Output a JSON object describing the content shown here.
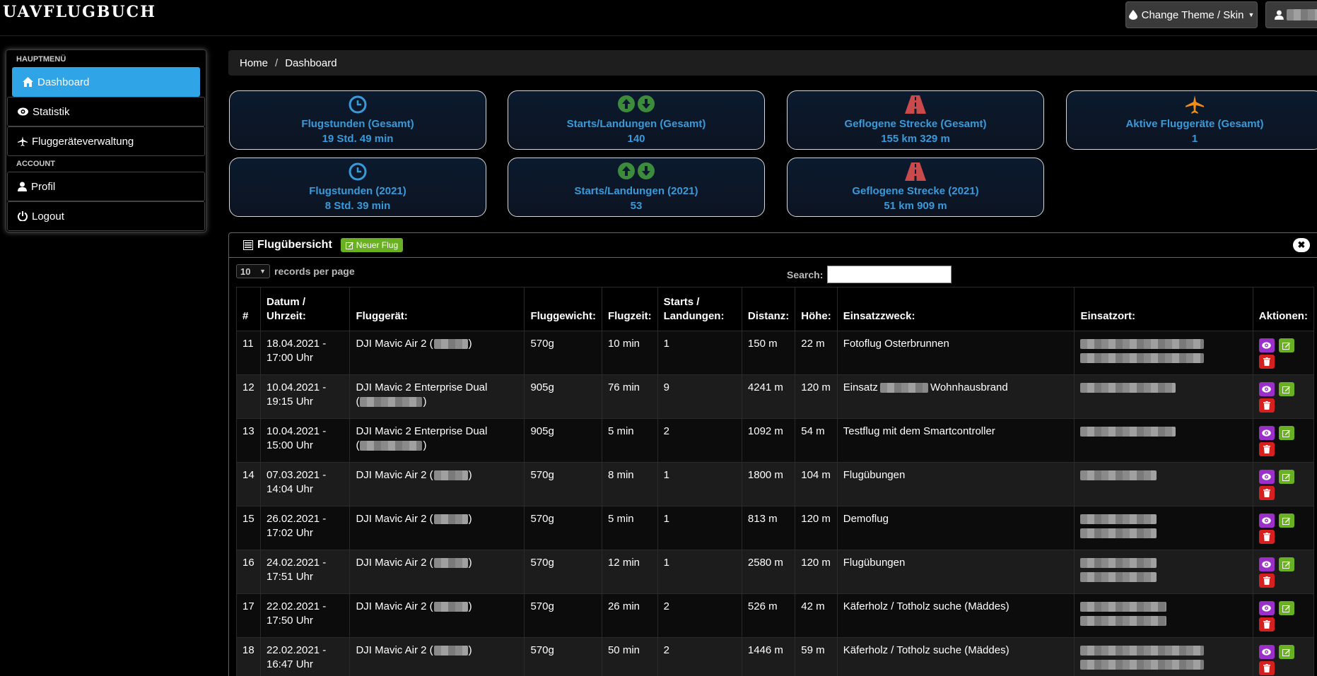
{
  "navbar": {
    "brand": "UAVFLUGBUCH",
    "theme_button": "Change Theme / Skin"
  },
  "sidebar": {
    "section_main": "HAUPTMENÜ",
    "section_account": "ACCOUNT",
    "items": [
      {
        "label": "Dashboard"
      },
      {
        "label": "Statistik"
      },
      {
        "label": "Fluggeräteverwaltung"
      },
      {
        "label": "Profil"
      },
      {
        "label": "Logout"
      }
    ]
  },
  "breadcrumb": {
    "home": "Home",
    "separator": "/",
    "current": "Dashboard"
  },
  "cards": [
    {
      "label": "Flugstunden (Gesamt)",
      "value": "19 Std. 49 min",
      "icon": "clock-icon"
    },
    {
      "label": "Starts/Landungen (Gesamt)",
      "value": "140",
      "icon": "arrows-up-down-icon"
    },
    {
      "label": "Geflogene Strecke (Gesamt)",
      "value": "155 km 329 m",
      "icon": "road-icon"
    },
    {
      "label": "Aktive Fluggeräte (Gesamt)",
      "value": "1",
      "icon": "plane-icon"
    },
    {
      "label": "Flugstunden (2021)",
      "value": "8 Std. 39 min",
      "icon": "clock-icon"
    },
    {
      "label": "Starts/Landungen (2021)",
      "value": "53",
      "icon": "arrows-up-down-icon"
    },
    {
      "label": "Geflogene Strecke (2021)",
      "value": "51 km 909 m",
      "icon": "road-icon"
    }
  ],
  "panel": {
    "title": "Flugübersicht",
    "new_button": "Neuer Flug",
    "close": "✖",
    "records_value": "10",
    "records_label": "records per page",
    "search_label": "Search:"
  },
  "table": {
    "headers": [
      "#",
      "Datum / Uhrzeit:",
      "Fluggerät:",
      "Fluggewicht:",
      "Flugzeit:",
      "Starts / Landungen:",
      "Distanz:",
      "Höhe:",
      "Einsatzzweck:",
      "Einsatzort:",
      "Aktionen:"
    ],
    "rows": [
      {
        "id": "11",
        "date": "18.04.2021 -",
        "time": "17:00 Uhr",
        "device": "DJI Mavic Air 2 (",
        "weight": "570g",
        "duration": "10 min",
        "starts": "1",
        "distance": "150 m",
        "height": "22 m",
        "purpose": "Fotoflug Osterbrunnen"
      },
      {
        "id": "12",
        "date": "10.04.2021 -",
        "time": "19:15 Uhr",
        "device": "DJI Mavic 2 Enterprise Dual",
        "weight": "905g",
        "duration": "76 min",
        "starts": "9",
        "distance": "4241 m",
        "height": "120 m",
        "purpose": "Einsatz",
        "purpose2": "Wohnhausbrand"
      },
      {
        "id": "13",
        "date": "10.04.2021 -",
        "time": "15:00 Uhr",
        "device": "DJI Mavic 2 Enterprise Dual",
        "weight": "905g",
        "duration": "5 min",
        "starts": "2",
        "distance": "1092 m",
        "height": "54 m",
        "purpose": "Testflug mit dem Smartcontroller"
      },
      {
        "id": "14",
        "date": "07.03.2021 -",
        "time": "14:04 Uhr",
        "device": "DJI Mavic Air 2 (",
        "weight": "570g",
        "duration": "8 min",
        "starts": "1",
        "distance": "1800 m",
        "height": "104 m",
        "purpose": "Flugübungen"
      },
      {
        "id": "15",
        "date": "26.02.2021 -",
        "time": "17:02 Uhr",
        "device": "DJI Mavic Air 2 (",
        "weight": "570g",
        "duration": "5 min",
        "starts": "1",
        "distance": "813 m",
        "height": "120 m",
        "purpose": "Demoflug"
      },
      {
        "id": "16",
        "date": "24.02.2021 -",
        "time": "17:51 Uhr",
        "device": "DJI Mavic Air 2 (",
        "weight": "570g",
        "duration": "12 min",
        "starts": "1",
        "distance": "2580 m",
        "height": "120 m",
        "purpose": "Flugübungen"
      },
      {
        "id": "17",
        "date": "22.02.2021 -",
        "time": "17:50 Uhr",
        "device": "DJI Mavic Air 2 (",
        "weight": "570g",
        "duration": "26 min",
        "starts": "2",
        "distance": "526 m",
        "height": "42 m",
        "purpose": "Käferholz / Totholz suche (Mäddes)"
      },
      {
        "id": "18",
        "date": "22.02.2021 -",
        "time": "16:47 Uhr",
        "device": "DJI Mavic Air 2 (",
        "weight": "570g",
        "duration": "50 min",
        "starts": "2",
        "distance": "1446 m",
        "height": "59 m",
        "purpose": "Käferholz / Totholz suche (Mäddes)"
      }
    ]
  }
}
